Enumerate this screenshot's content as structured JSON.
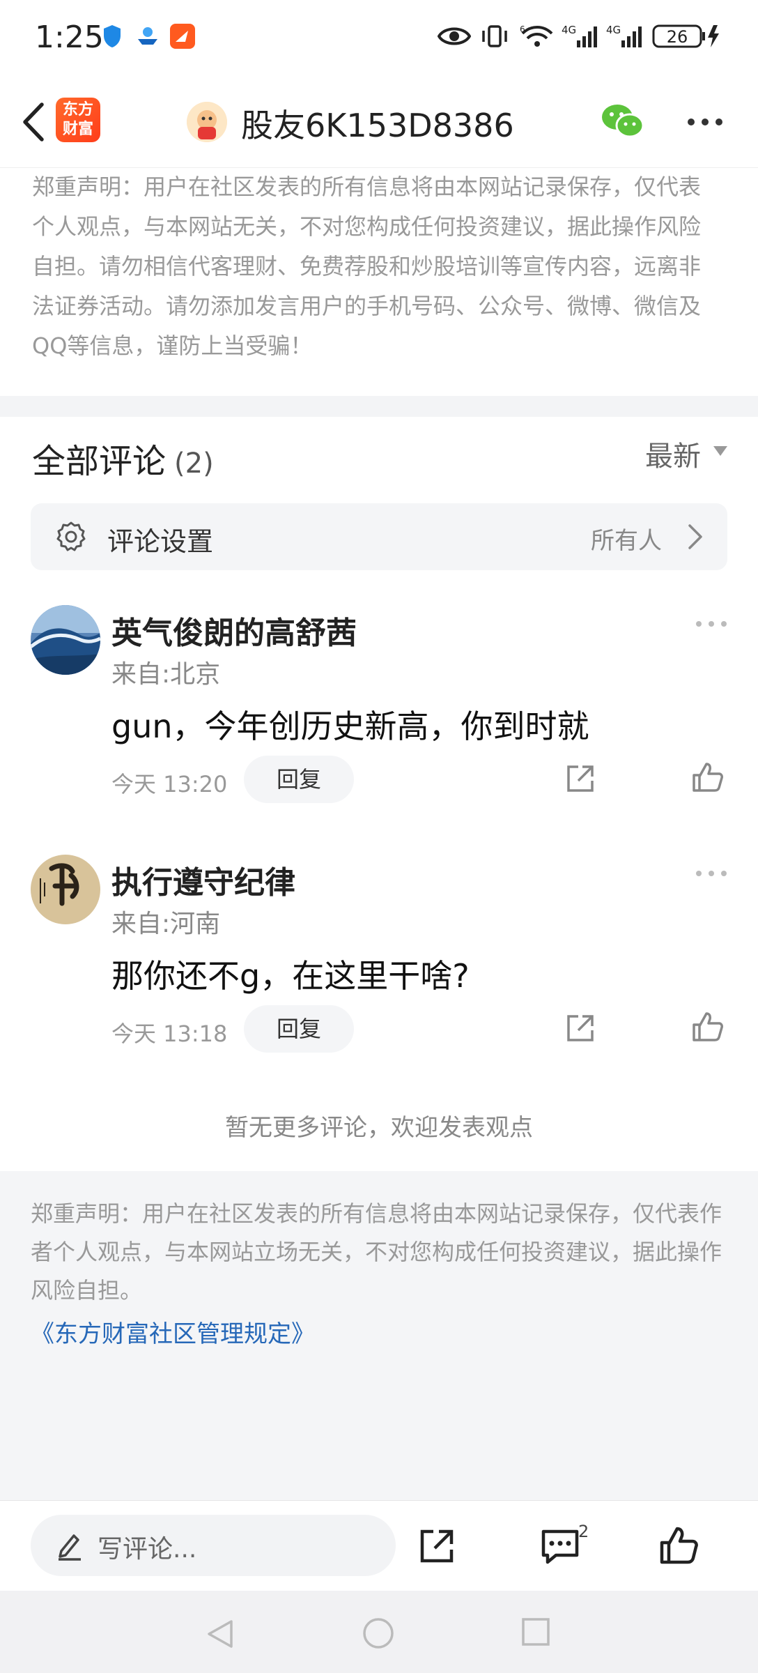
{
  "status": {
    "time": "1:25",
    "network_labels": [
      "4G",
      "4G"
    ],
    "wifi_label": "6",
    "battery": "26"
  },
  "nav": {
    "logo_text": "东方财富",
    "title": "股友6K153D8386"
  },
  "notice_top": "郑重声明：用户在社区发表的所有信息将由本网站记录保存，仅代表个人观点，与本网站无关，不对您构成任何投资建议，据此操作风险自担。请勿相信代客理财、免费荐股和炒股培训等宣传内容，远离非法证券活动。请勿添加发言用户的手机号码、公众号、微博、微信及QQ等信息，谨防上当受骗！",
  "comments_header": {
    "title": "全部评论",
    "count": "(2)",
    "sort": "最新"
  },
  "settings": {
    "label": "评论设置",
    "value": "所有人"
  },
  "comments": [
    {
      "name": "英气俊朗的高舒茜",
      "location": "来自:北京",
      "text": "gun，今年创历史新高，你到时就",
      "time": "今天 13:20",
      "reply_label": "回复"
    },
    {
      "name": "执行遵守纪律",
      "location": "来自:河南",
      "text": "那你还不g，在这里干啥?",
      "time": "今天 13:18",
      "reply_label": "回复"
    }
  ],
  "no_more": "暂无更多评论，欢迎发表观点",
  "footer": {
    "notice": "郑重声明：用户在社区发表的所有信息将由本网站记录保存，仅代表作者个人观点，与本网站立场无关，不对您构成任何投资建议，据此操作风险自担。",
    "link": "《东方财富社区管理规定》"
  },
  "bottom_bar": {
    "write_placeholder": "写评论...",
    "comment_badge": "2"
  },
  "colors": {
    "accent_red": "#ff4a1f",
    "link_blue": "#2668b8",
    "wechat_green": "#5cc33b"
  }
}
